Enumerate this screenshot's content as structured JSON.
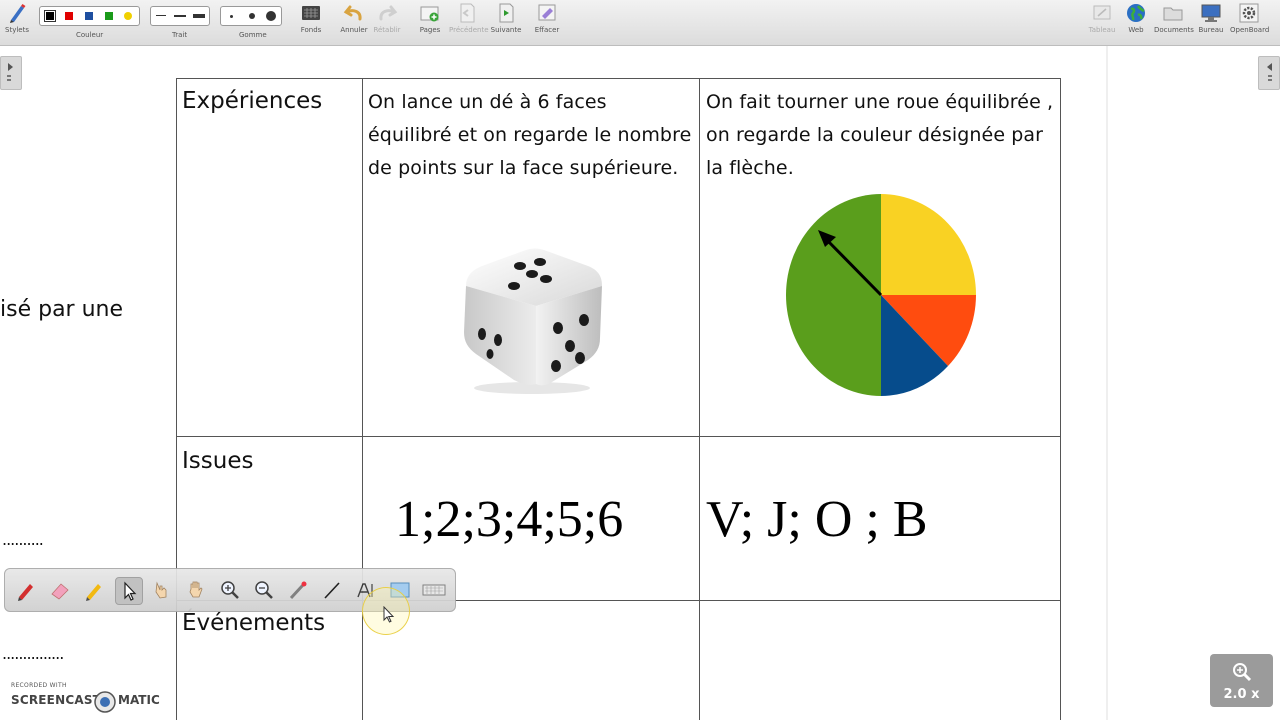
{
  "toolbar": {
    "stylets": "Stylets",
    "couleur": "Couleur",
    "trait": "Trait",
    "gomme": "Gomme",
    "fonds": "Fonds",
    "annuler": "Annuler",
    "retablir": "Rétablir",
    "pages": "Pages",
    "precedente": "Précédente",
    "suivante": "Suivante",
    "effacer": "Effacer",
    "tableau": "Tableau",
    "web": "Web",
    "documents": "Documents",
    "bureau": "Bureau",
    "openboard": "OpenBoard",
    "colors": [
      "#000000",
      "#e00000",
      "#1e4fa0",
      "#1a9a1a",
      "#f0d000"
    ]
  },
  "document": {
    "row1_title": "Expériences",
    "exp1_text": "On lance un dé à 6 faces équilibré et on regarde le nombre de points sur la face supérieure.",
    "exp2_text": "On fait tourner une roue équilibrée , on regarde la couleur désignée par la flèche.",
    "row2_title": "Issues",
    "issues1": "1;2;3;4;5;6",
    "issues2": "V; J; O ; B",
    "row3_title": "Événements",
    "margin_text": "isé par une",
    "margin_dots_1": "..........",
    "margin_dots_2": "..............."
  },
  "wheel": {
    "colors": {
      "green": "#5a9e1c",
      "yellow": "#f9d223",
      "orange": "#ff4c0f",
      "blue": "#064c8c"
    }
  },
  "zoom": {
    "label": "2.0 x"
  },
  "watermark": {
    "small": "RECORDED WITH",
    "left": "SCREENCAST",
    "right": "MATIC"
  }
}
